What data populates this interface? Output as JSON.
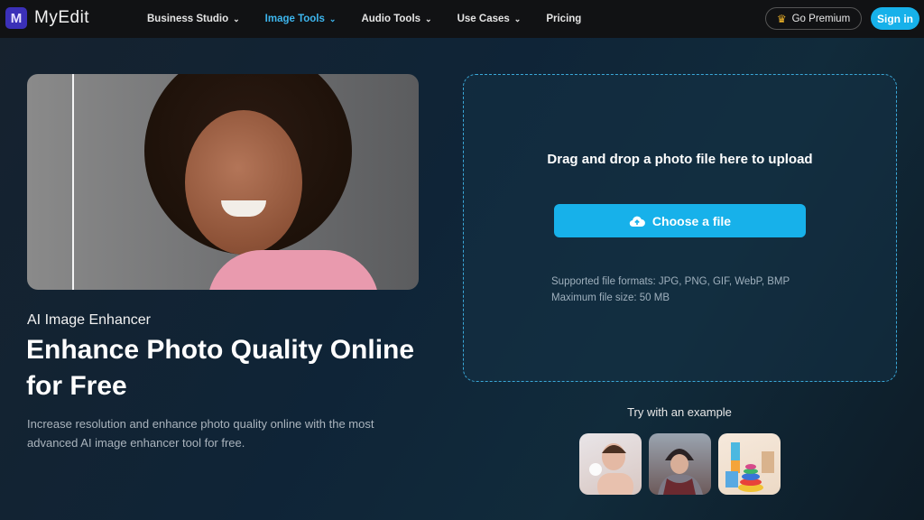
{
  "nav": {
    "logo_text": "MyEdit",
    "logo_mark": "M",
    "menu": [
      {
        "label": "Business Studio",
        "has_dropdown": true,
        "active": false
      },
      {
        "label": "Image Tools",
        "has_dropdown": true,
        "active": true
      },
      {
        "label": "Audio Tools",
        "has_dropdown": true,
        "active": false
      },
      {
        "label": "Use Cases",
        "has_dropdown": true,
        "active": false
      },
      {
        "label": "Pricing",
        "has_dropdown": false,
        "active": false
      }
    ],
    "premium_label": "Go Premium",
    "premium_icon": "crown-icon",
    "signin_label": "Sign in"
  },
  "hero": {
    "image_alt": "Smiling woman with curly hair in pink top, before/after comparison",
    "subtitle": "AI Image Enhancer",
    "title": "Enhance Photo Quality Online for Free",
    "description": "Increase resolution and enhance photo quality online with the most advanced AI image enhancer tool for free."
  },
  "upload": {
    "drop_text": "Drag and drop a photo file here to upload",
    "button_label": "Choose a file",
    "button_icon": "cloud-upload-icon",
    "formats": "Supported file formats: JPG, PNG, GIF, WebP, BMP",
    "max_size": "Maximum file size: 50 MB"
  },
  "examples": {
    "label": "Try with an example",
    "items": [
      "Woman holding skincare product",
      "Woman in beanie and scarf",
      "Colorful stacking toys"
    ]
  },
  "colors": {
    "accent": "#17b1ea",
    "nav_bg": "#111214",
    "active_nav": "#3db6ee"
  }
}
